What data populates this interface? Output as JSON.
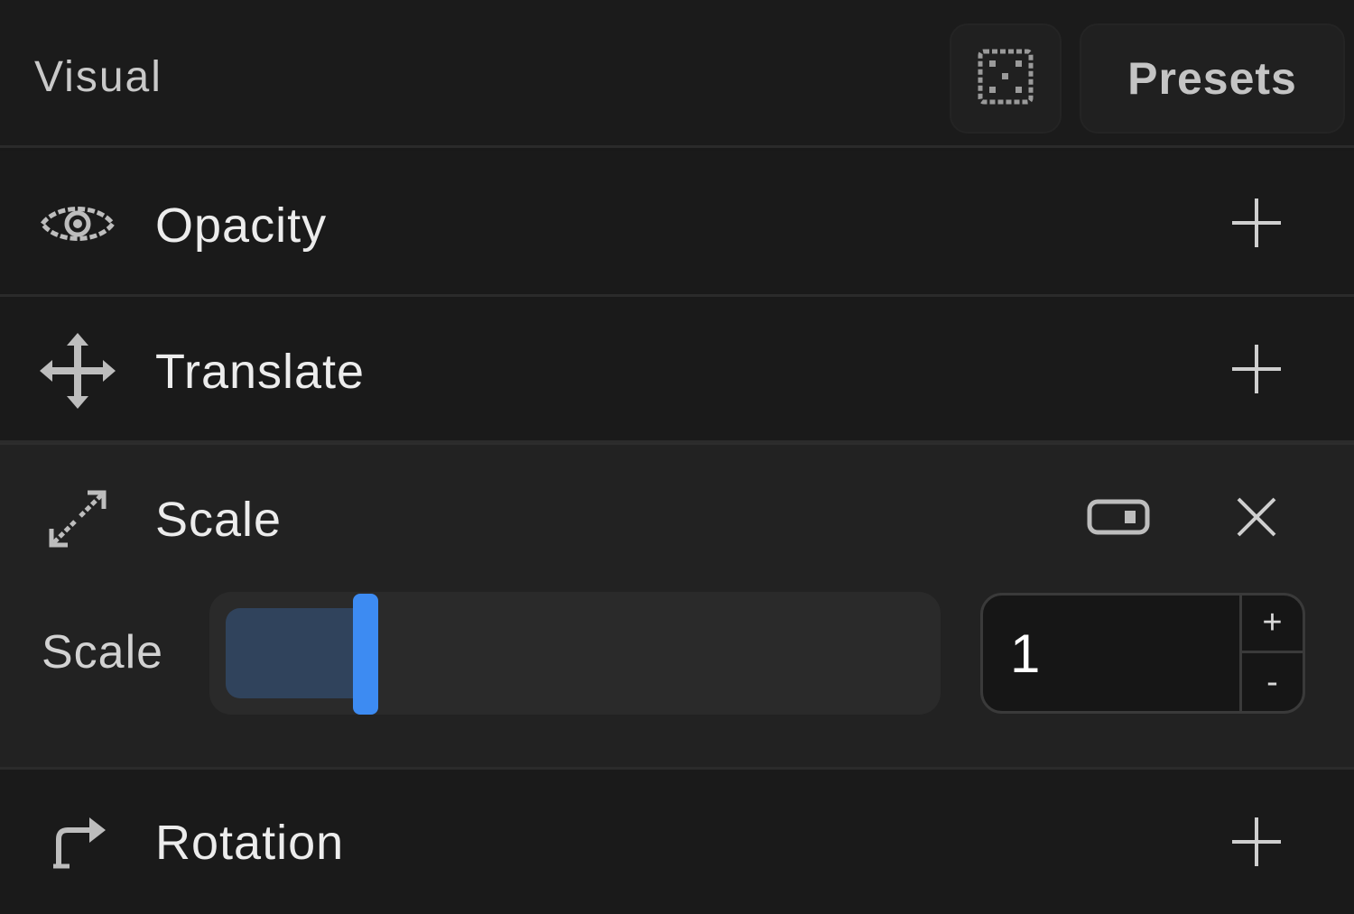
{
  "header": {
    "title": "Visual",
    "random_icon": "dice-icon",
    "presets_label": "Presets"
  },
  "properties": [
    {
      "label": "Opacity",
      "icon": "eye-icon",
      "action_icon": "plus-icon"
    },
    {
      "label": "Translate",
      "icon": "move-arrows-icon",
      "action_icon": "plus-icon"
    },
    {
      "label": "Scale",
      "icon": "scale-arrows-icon",
      "expanded": true,
      "toggle_icon": "toggle-icon",
      "close_icon": "close-icon",
      "field": {
        "label": "Scale",
        "value": "1",
        "slider_fraction": 0.2,
        "increment_label": "+",
        "decrement_label": "-"
      }
    },
    {
      "label": "Rotation",
      "icon": "rotate-right-icon",
      "action_icon": "plus-icon"
    }
  ],
  "colors": {
    "background": "#191919",
    "accent": "#3d8bf2",
    "slider_fill": "#30435c"
  }
}
